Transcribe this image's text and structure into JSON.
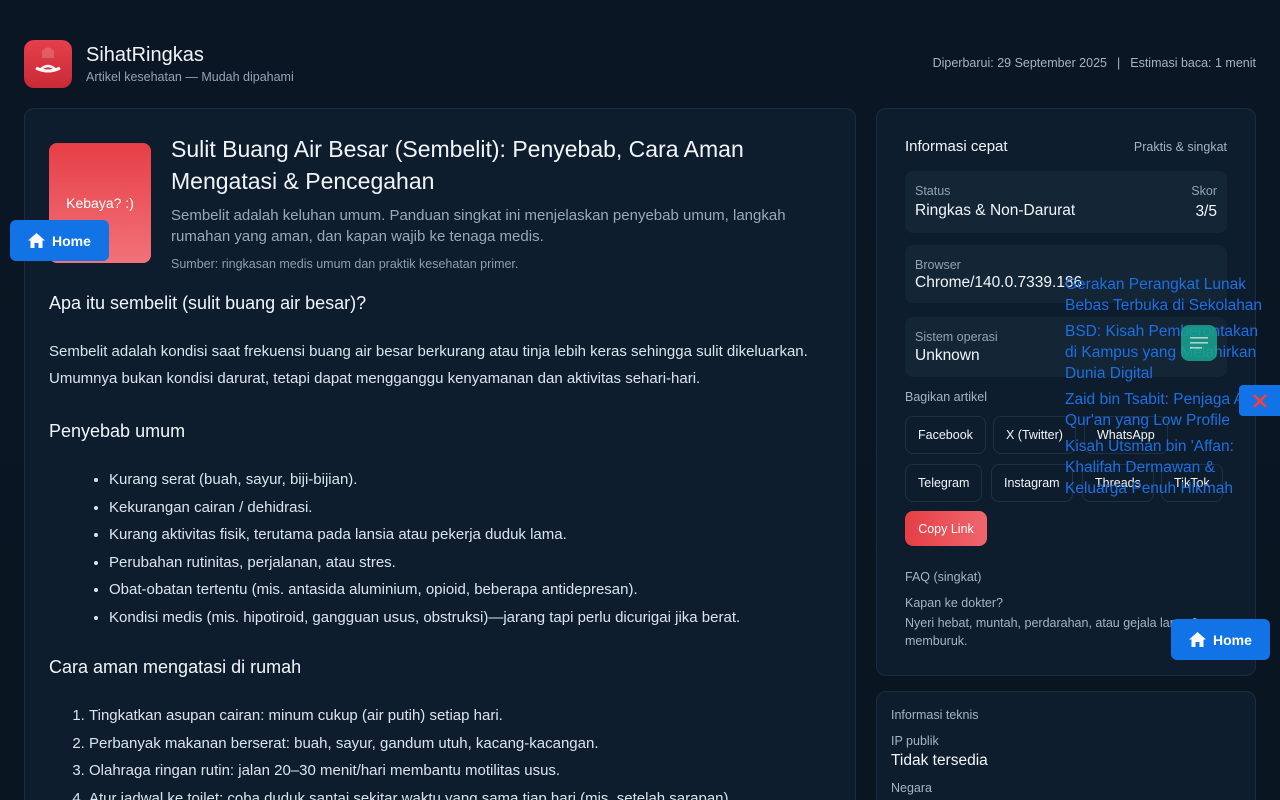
{
  "header": {
    "brand_title": "SihatRingkas",
    "brand_subtitle": "Artikel kesehatan — Mudah dipahami",
    "updated": "Diperbarui: 29 September 2025",
    "separator": "|",
    "reading_time": "Estimasi baca: 1 menit"
  },
  "article": {
    "thumb_text": "Kebaya? :)",
    "title": "Sulit Buang Air Besar (Sembelit): Penyebab, Cara Aman Mengatasi & Pencegahan",
    "description": "Sembelit adalah keluhan umum. Panduan singkat ini menjelaskan penyebab umum, langkah rumahan yang aman, dan kapan wajib ke tenaga medis.",
    "source": "Sumber: ringkasan medis umum dan praktik kesehatan primer.",
    "section1_title": "Apa itu sembelit (sulit buang air besar)?",
    "section1_text": "Sembelit adalah kondisi saat frekuensi buang air besar berkurang atau tinja lebih keras sehingga sulit dikeluarkan. Umumnya bukan kondisi darurat, tetapi dapat mengganggu kenyamanan dan aktivitas sehari-hari.",
    "section2_title": "Penyebab umum",
    "causes": [
      "Kurang serat (buah, sayur, biji-bijian).",
      "Kekurangan cairan / dehidrasi.",
      "Kurang aktivitas fisik, terutama pada lansia atau pekerja duduk lama.",
      "Perubahan rutinitas, perjalanan, atau stres.",
      "Obat-obatan tertentu (mis. antasida aluminium, opioid, beberapa antidepresan).",
      "Kondisi medis (mis. hipotiroid, gangguan usus, obstruksi)—jarang tapi perlu dicurigai jika berat."
    ],
    "section3_title": "Cara aman mengatasi di rumah",
    "remedies": [
      "Tingkatkan asupan cairan: minum cukup (air putih) setiap hari.",
      "Perbanyak makanan berserat: buah, sayur, gandum utuh, kacang-kacangan.",
      "Olahraga ringan rutin: jalan 20–30 menit/hari membantu motilitas usus.",
      "Atur jadwal ke toilet: coba duduk santai sekitar waktu yang sama tiap hari (mis. setelah sarapan)."
    ]
  },
  "info": {
    "title": "Informasi cepat",
    "note": "Praktis & singkat",
    "status_label": "Status",
    "status_value": "Ringkas & Non-Darurat",
    "score_label": "Skor",
    "score_value": "3/5",
    "browser_label": "Browser",
    "browser_value": "Chrome/140.0.7339.186",
    "os_label": "Sistem operasi",
    "os_value": "Unknown",
    "share_label": "Bagikan artikel",
    "share_buttons": [
      "Facebook",
      "X (Twitter)",
      "WhatsApp",
      "Telegram",
      "Instagram",
      "Threads",
      "TikTok"
    ],
    "copy_label": "Copy Link",
    "faq_label": "FAQ (singkat)",
    "faq_question": "Kapan ke dokter?",
    "faq_answer": "Nyeri hebat, muntah, perdarahan, atau gejala lama & memburuk."
  },
  "tech": {
    "title": "Informasi teknis",
    "ip_label": "IP publik",
    "ip_value": "Tidak tersedia",
    "country_label": "Negara"
  },
  "overlay": {
    "home_label": "Home",
    "related": [
      "Gerakan Perangkat Lunak Bebas Terbuka di Sekolahan",
      "BSD: Kisah Pemberontakan di Kampus yang Melahirkan Dunia Digital",
      "Zaid bin Tsabit: Penjaga Al-Qur'an yang Low Profile",
      "Kisah Utsman bin 'Affan: Khalifah Dermawan & Keluarga Penuh Hikmah"
    ]
  },
  "colors": {
    "brand_red": "#e4404a",
    "home_blue": "#1273e6",
    "menu_teal": "#18a48f",
    "link_blue": "#1e6fe0"
  }
}
